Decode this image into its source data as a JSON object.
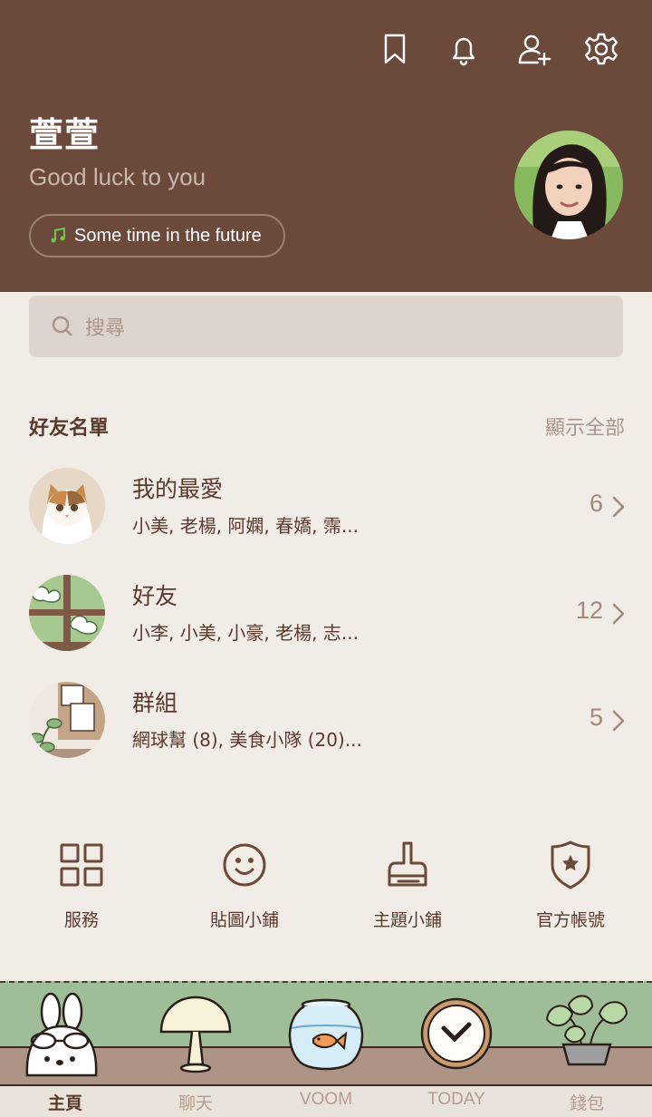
{
  "header": {
    "icons": [
      "bookmark-icon",
      "bell-icon",
      "add-friend-icon",
      "gear-icon"
    ],
    "name": "萱萱",
    "status": "Good luck to you",
    "music": "Some time in the future",
    "colors": {
      "background": "#6b4a3b",
      "music_note": "#6dc84a"
    }
  },
  "search": {
    "placeholder": "搜尋"
  },
  "friends": {
    "title": "好友名單",
    "show_all": "顯示全部",
    "rows": [
      {
        "title": "我的最愛",
        "subtitle": "小美, 老楊, 阿嫻, 春嬌, 霈...",
        "count": "6"
      },
      {
        "title": "好友",
        "subtitle": "小李, 小美, 小豪, 老楊, 志...",
        "count": "12"
      },
      {
        "title": "群組",
        "subtitle": "網球幫 (8), 美食小隊 (20)...",
        "count": "5"
      }
    ]
  },
  "quick_actions": [
    {
      "label": "服務",
      "icon": "grid-icon"
    },
    {
      "label": "貼圖小鋪",
      "icon": "smiley-icon"
    },
    {
      "label": "主題小鋪",
      "icon": "brush-icon"
    },
    {
      "label": "官方帳號",
      "icon": "shield-star-icon"
    }
  ],
  "tabs": [
    {
      "label": "主頁",
      "icon": "bunny-icon",
      "active": true
    },
    {
      "label": "聊天",
      "icon": "lamp-icon",
      "active": false
    },
    {
      "label": "VOOM",
      "icon": "fishbowl-icon",
      "active": false
    },
    {
      "label": "TODAY",
      "icon": "clock-icon",
      "active": false
    },
    {
      "label": "錢包",
      "icon": "plant-icon",
      "active": false
    }
  ]
}
